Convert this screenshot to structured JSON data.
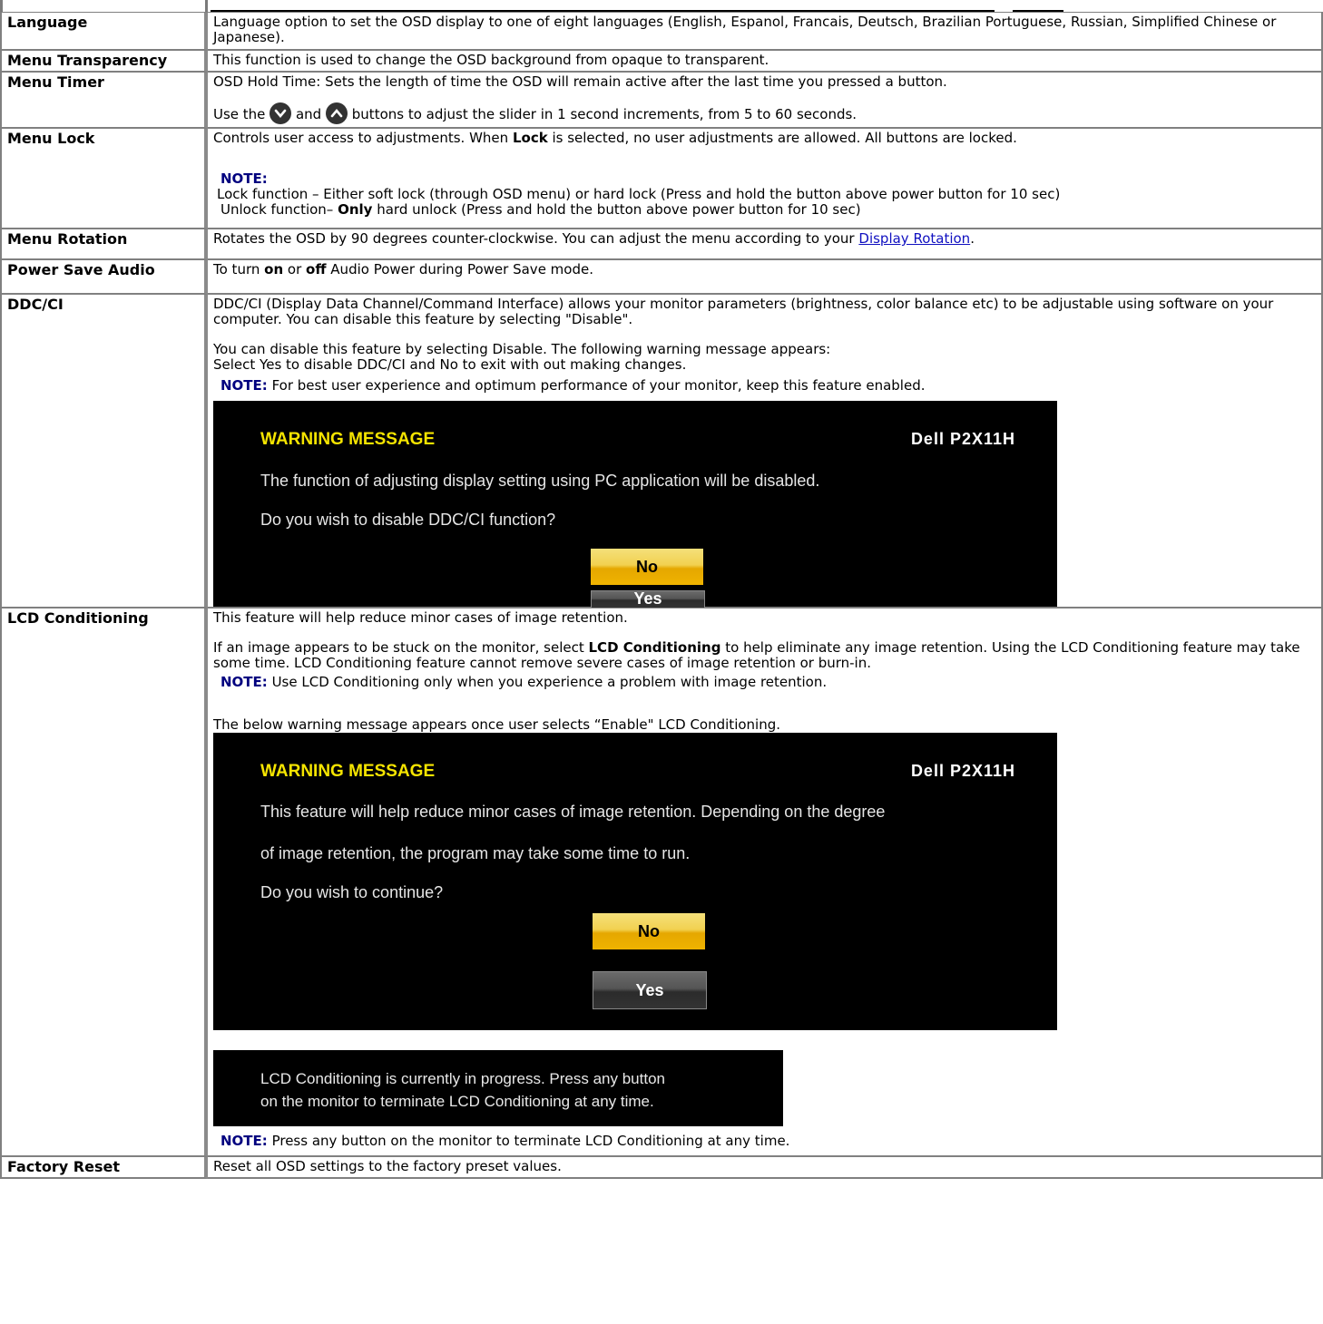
{
  "rows": {
    "language": {
      "label": "Language",
      "desc": "Language option to set the OSD display to one of eight languages (English, Espanol, Francais, Deutsch, Brazilian Portuguese, Russian, Simplified Chinese or Japanese)."
    },
    "transparency": {
      "label": "Menu Transparency",
      "desc": "This function is used to change the OSD background from opaque to transparent."
    },
    "timer": {
      "label": "Menu Timer",
      "line1": "OSD Hold Time: Sets the length of time the OSD will remain active after the last time you pressed a button.",
      "use_the": "Use the",
      "and": "and",
      "rest": "buttons to adjust the slider in 1 second increments, from 5 to 60 seconds.",
      "icons": [
        "chevron-down-circle-icon",
        "chevron-up-circle-icon"
      ]
    },
    "lock": {
      "label": "Menu Lock",
      "desc_a": "Controls user access to adjustments. When",
      "desc_bold": "Lock",
      "desc_b": "is selected, no user adjustments are allowed. All buttons are locked.",
      "note_label": "NOTE:",
      "note_line1": "Lock function – Either soft lock (through OSD menu) or hard lock (Press and hold the button above power button for 10 sec)",
      "note_line2_a": "Unlock function–",
      "note_line2_bold": "Only",
      "note_line2_b": "hard unlock (Press and hold the button above power button for 10 sec)"
    },
    "rotation": {
      "label": "Menu Rotation",
      "desc": "Rotates the OSD by 90 degrees counter-clockwise. You can adjust the menu according to your",
      "link": "Display Rotation",
      "end": "."
    },
    "power_audio": {
      "label": "Power Save Audio",
      "a": "To turn",
      "on": "on",
      "or": "or",
      "off": "off",
      "b": "Audio Power during Power Save mode."
    },
    "ddcci": {
      "label": "DDC/CI",
      "p1": "DDC/CI (Display Data Channel/Command Interface) allows your monitor parameters (brightness, color balance etc) to be adjustable using software on your computer. You can disable this feature by selecting \"Disable\".",
      "p2": "You can disable this feature by selecting Disable. The following warning message appears:",
      "p3": "Select Yes to disable DDC/CI and No to exit with out making changes.",
      "note_label": "NOTE:",
      "note": "For best user experience and optimum performance of your monitor, keep this feature enabled.",
      "osd": {
        "title": "WARNING MESSAGE",
        "model": "Dell P2X11H",
        "line1": "The function of adjusting display setting using PC application will be disabled.",
        "line2": "Do you wish to disable DDC/CI function?",
        "no": "No",
        "yes": "Yes"
      }
    },
    "lcd": {
      "label": "LCD Conditioning",
      "p1": "This feature will help reduce minor cases of image retention.",
      "p2_a": "If an image appears to be stuck on the monitor, select",
      "p2_bold": "LCD Conditioning",
      "p2_b": "to help eliminate any image retention. Using the LCD Conditioning feature may take some time. LCD Conditioning feature cannot remove  severe cases of image retention or burn-in.",
      "note_label": "NOTE:",
      "note1": "Use LCD Conditioning only when you experience a problem with image retention.",
      "p3": "The below warning message appears once user selects “Enable\" LCD Conditioning.",
      "osd": {
        "title": "WARNING MESSAGE",
        "model": "Dell P2X11H",
        "line1": "This feature will help reduce minor cases of image retention. Depending on the degree",
        "line2": "of image retention, the program may take some time to run.",
        "line3": "Do you wish to continue?",
        "no": "No",
        "yes": "Yes"
      },
      "progress_line1": "LCD Conditioning is currently in progress. Press any button",
      "progress_line2": "on the monitor to terminate LCD Conditioning at any time.",
      "note2": "Press any button on the monitor to terminate LCD Conditioning at any time."
    },
    "factory": {
      "label": "Factory Reset",
      "desc": "Reset all OSD settings to the factory preset values."
    }
  },
  "colors": {
    "note": "#00007f",
    "osd_title": "#f5e400",
    "no_button": "#efb300",
    "link": "#1010c0"
  }
}
